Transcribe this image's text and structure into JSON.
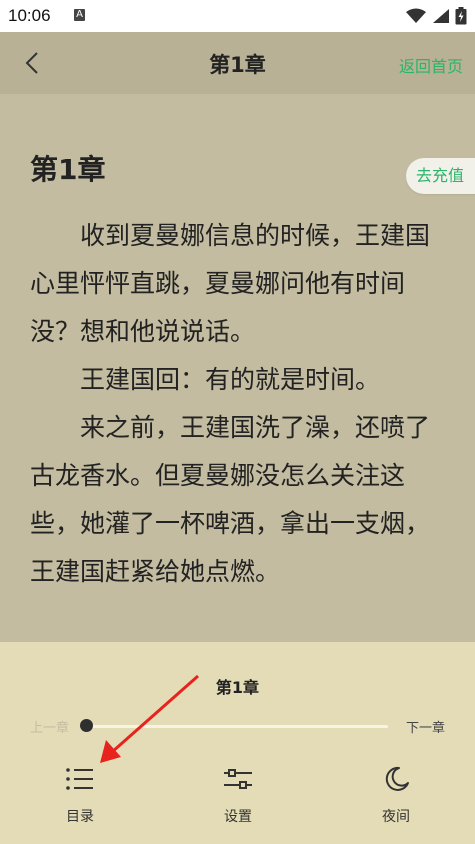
{
  "status_bar": {
    "time": "10:06",
    "notification_icon": "A"
  },
  "header": {
    "title": "第1章",
    "home_link": "返回首页",
    "back_icon": "chevron-left-icon"
  },
  "reader": {
    "chapter_heading": "第1章",
    "recharge_button": "去充值",
    "paragraphs": [
      "收到夏曼娜信息的时候，王建国心里怦怦直跳，夏曼娜问他有时间没？想和他说说话。",
      "王建国回：有的就是时间。",
      "来之前，王建国洗了澡，还喷了古龙香水。但夏曼娜没怎么关注这些，她灌了一杯啤酒，拿出一支烟，王建国赶紧给她点燃。"
    ]
  },
  "bottom_panel": {
    "chapter_title": "第1章",
    "prev_chapter": "上一章",
    "next_chapter": "下一章",
    "progress": 0,
    "tools": [
      {
        "label": "目录",
        "icon": "list-icon"
      },
      {
        "label": "设置",
        "icon": "sliders-icon"
      },
      {
        "label": "夜间",
        "icon": "moon-icon"
      }
    ]
  },
  "colors": {
    "accent": "#2bb46a",
    "page_bg": "#c3bca0",
    "header_bg": "#b8b195",
    "panel_bg": "#e3dcb6",
    "annotation": "#e8221c"
  }
}
